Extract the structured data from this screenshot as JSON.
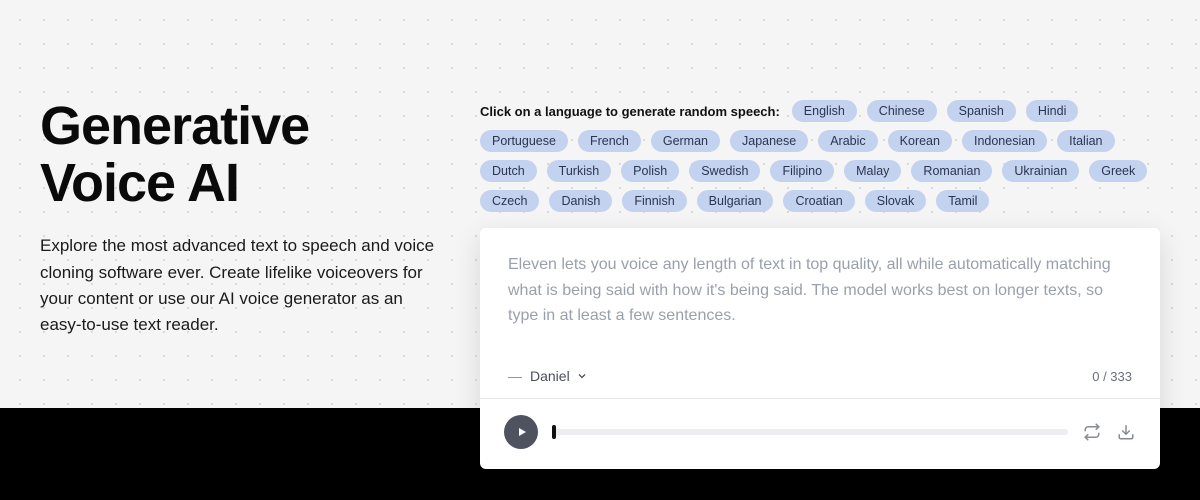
{
  "hero": {
    "title_line1": "Generative",
    "title_line2": "Voice AI",
    "description": "Explore the most advanced text to speech and voice cloning software ever. Create lifelike voiceovers for your content or use our AI voice generator as an easy-to-use text reader."
  },
  "languages": {
    "label": "Click on a language to generate random speech:",
    "items": [
      "English",
      "Chinese",
      "Spanish",
      "Hindi",
      "Portuguese",
      "French",
      "German",
      "Japanese",
      "Arabic",
      "Korean",
      "Indonesian",
      "Italian",
      "Dutch",
      "Turkish",
      "Polish",
      "Swedish",
      "Filipino",
      "Malay",
      "Romanian",
      "Ukrainian",
      "Greek",
      "Czech",
      "Danish",
      "Finnish",
      "Bulgarian",
      "Croatian",
      "Slovak",
      "Tamil"
    ]
  },
  "panel": {
    "placeholder": "Eleven lets you voice any length of text in top quality, all while automatically matching what is being said with how it's being said. The model works best on longer texts, so type in at least a few sentences.",
    "voice_name": "Daniel",
    "char_count": "0 / 333"
  }
}
